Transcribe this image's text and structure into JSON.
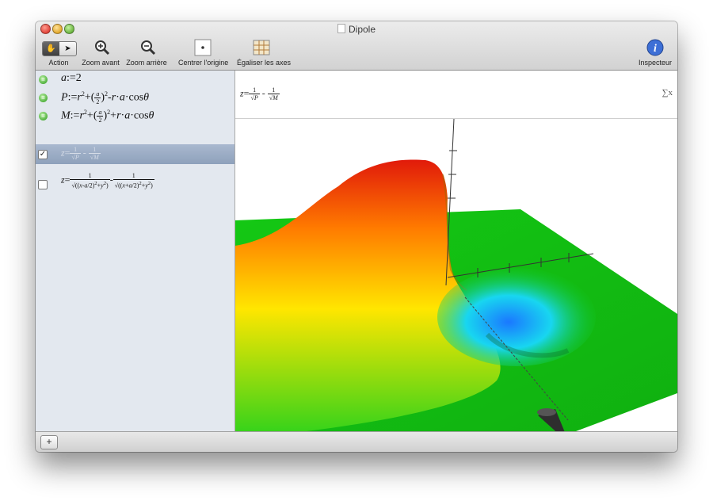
{
  "window": {
    "title": "Dipole"
  },
  "toolbar": {
    "action_label": "Action",
    "zoom_in_label": "Zoom avant",
    "zoom_out_label": "Zoom arrière",
    "center_label": "Centrer l'origine",
    "equalize_label": "Égaliser les axes",
    "inspector_label": "Inspecteur"
  },
  "sidebar": {
    "items": [
      {
        "text": "a:=2",
        "kind": "definition",
        "enabled": true
      },
      {
        "text": "P:=r2+(a/2)2-r·a·cosθ",
        "kind": "definition",
        "enabled": true
      },
      {
        "text": "M:=r2+(a/2)2+r·a·cosθ",
        "kind": "definition",
        "enabled": true
      },
      {
        "text": "z=1/√P - 1/√M",
        "kind": "plot",
        "checked": true,
        "selected": true
      },
      {
        "text": "z=1/√((x-a/2)2+y2) - 1/√((x+a/2)2+y2)",
        "kind": "plot",
        "checked": false
      }
    ]
  },
  "main": {
    "expression": "z=1/√P - 1/√M",
    "sigma_label": "∑x"
  },
  "bottom": {
    "add_label": "+"
  },
  "colors": {
    "selection": "#9fb0c9",
    "surface_green": "#12c812",
    "peak_red": "#e11a0a",
    "trough_blue": "#1a78ff"
  },
  "icons": [
    "hand-icon",
    "arrow-icon",
    "zoom-in-icon",
    "zoom-out-icon",
    "center-origin-icon",
    "equalize-axes-icon",
    "info-icon",
    "document-icon",
    "equals-badge-icon"
  ]
}
